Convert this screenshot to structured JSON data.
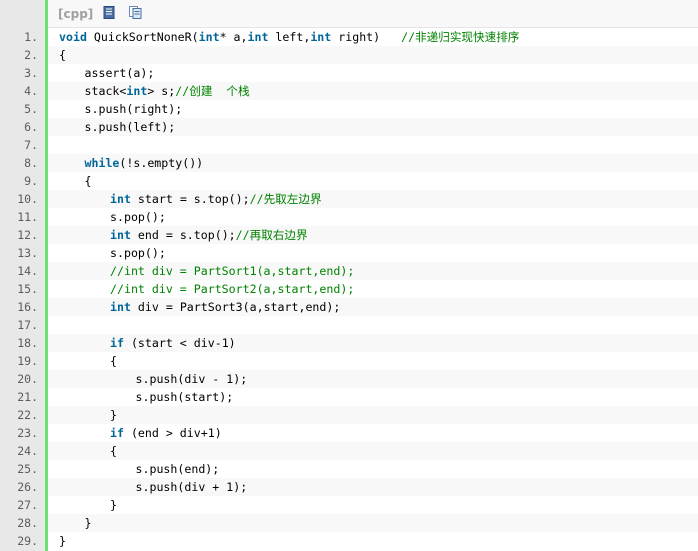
{
  "toolbar": {
    "lang_label": "[cpp]",
    "view_source_icon": "view-plain-icon",
    "copy_icon": "copy-icon"
  },
  "colors": {
    "keyword": "#006699",
    "comment": "#008200",
    "gutter_border": "#6ce26c",
    "gutter_bg": "#e8e8e8",
    "alt_row_bg": "#f8f8f8"
  },
  "lines": [
    {
      "num": "1.",
      "indent": 0,
      "tokens": [
        {
          "t": "void",
          "c": "kw"
        },
        {
          "t": " QuickSortNoneR("
        },
        {
          "t": "int",
          "c": "kw"
        },
        {
          "t": "* a,"
        },
        {
          "t": "int",
          "c": "kw"
        },
        {
          "t": " left,"
        },
        {
          "t": "int",
          "c": "kw"
        },
        {
          "t": " right)   "
        },
        {
          "t": "//非递归实现快速排序",
          "c": "cm"
        }
      ]
    },
    {
      "num": "2.",
      "indent": 0,
      "tokens": [
        {
          "t": "{"
        }
      ]
    },
    {
      "num": "3.",
      "indent": 1,
      "tokens": [
        {
          "t": "assert(a);"
        }
      ]
    },
    {
      "num": "4.",
      "indent": 1,
      "tokens": [
        {
          "t": "stack<"
        },
        {
          "t": "int",
          "c": "kw"
        },
        {
          "t": "> s;"
        },
        {
          "t": "//创建  个栈",
          "c": "cm"
        }
      ]
    },
    {
      "num": "5.",
      "indent": 1,
      "tokens": [
        {
          "t": "s.push(right);"
        }
      ]
    },
    {
      "num": "6.",
      "indent": 1,
      "tokens": [
        {
          "t": "s.push(left);"
        }
      ]
    },
    {
      "num": "7.",
      "indent": 0,
      "tokens": []
    },
    {
      "num": "8.",
      "indent": 1,
      "tokens": [
        {
          "t": "while",
          "c": "kw"
        },
        {
          "t": "(!s.empty())"
        }
      ]
    },
    {
      "num": "9.",
      "indent": 1,
      "tokens": [
        {
          "t": "{"
        }
      ]
    },
    {
      "num": "10.",
      "indent": 2,
      "tokens": [
        {
          "t": "int",
          "c": "kw"
        },
        {
          "t": " start = s.top();"
        },
        {
          "t": "//先取左边界",
          "c": "cm"
        }
      ]
    },
    {
      "num": "11.",
      "indent": 2,
      "tokens": [
        {
          "t": "s.pop();"
        }
      ]
    },
    {
      "num": "12.",
      "indent": 2,
      "tokens": [
        {
          "t": "int",
          "c": "kw"
        },
        {
          "t": " end = s.top();"
        },
        {
          "t": "//再取右边界",
          "c": "cm"
        }
      ]
    },
    {
      "num": "13.",
      "indent": 2,
      "tokens": [
        {
          "t": "s.pop();"
        }
      ]
    },
    {
      "num": "14.",
      "indent": 2,
      "tokens": [
        {
          "t": "//int div = PartSort1(a,start,end);",
          "c": "cm"
        }
      ]
    },
    {
      "num": "15.",
      "indent": 2,
      "tokens": [
        {
          "t": "//int div = PartSort2(a,start,end);",
          "c": "cm"
        }
      ]
    },
    {
      "num": "16.",
      "indent": 2,
      "tokens": [
        {
          "t": "int",
          "c": "kw"
        },
        {
          "t": " div = PartSort3(a,start,end);"
        }
      ]
    },
    {
      "num": "17.",
      "indent": 0,
      "tokens": []
    },
    {
      "num": "18.",
      "indent": 2,
      "tokens": [
        {
          "t": "if",
          "c": "kw"
        },
        {
          "t": " (start < div-1)"
        }
      ]
    },
    {
      "num": "19.",
      "indent": 2,
      "tokens": [
        {
          "t": "{"
        }
      ]
    },
    {
      "num": "20.",
      "indent": 3,
      "tokens": [
        {
          "t": "s.push(div - 1);"
        }
      ]
    },
    {
      "num": "21.",
      "indent": 3,
      "tokens": [
        {
          "t": "s.push(start);"
        }
      ]
    },
    {
      "num": "22.",
      "indent": 2,
      "tokens": [
        {
          "t": "}"
        }
      ]
    },
    {
      "num": "23.",
      "indent": 2,
      "tokens": [
        {
          "t": "if",
          "c": "kw"
        },
        {
          "t": " (end > div+1)"
        }
      ]
    },
    {
      "num": "24.",
      "indent": 2,
      "tokens": [
        {
          "t": "{"
        }
      ]
    },
    {
      "num": "25.",
      "indent": 3,
      "tokens": [
        {
          "t": "s.push(end);"
        }
      ]
    },
    {
      "num": "26.",
      "indent": 3,
      "tokens": [
        {
          "t": "s.push(div + 1);"
        }
      ]
    },
    {
      "num": "27.",
      "indent": 2,
      "tokens": [
        {
          "t": "}"
        }
      ]
    },
    {
      "num": "28.",
      "indent": 1,
      "tokens": [
        {
          "t": "}"
        }
      ]
    },
    {
      "num": "29.",
      "indent": 0,
      "tokens": [
        {
          "t": "}"
        }
      ]
    }
  ]
}
